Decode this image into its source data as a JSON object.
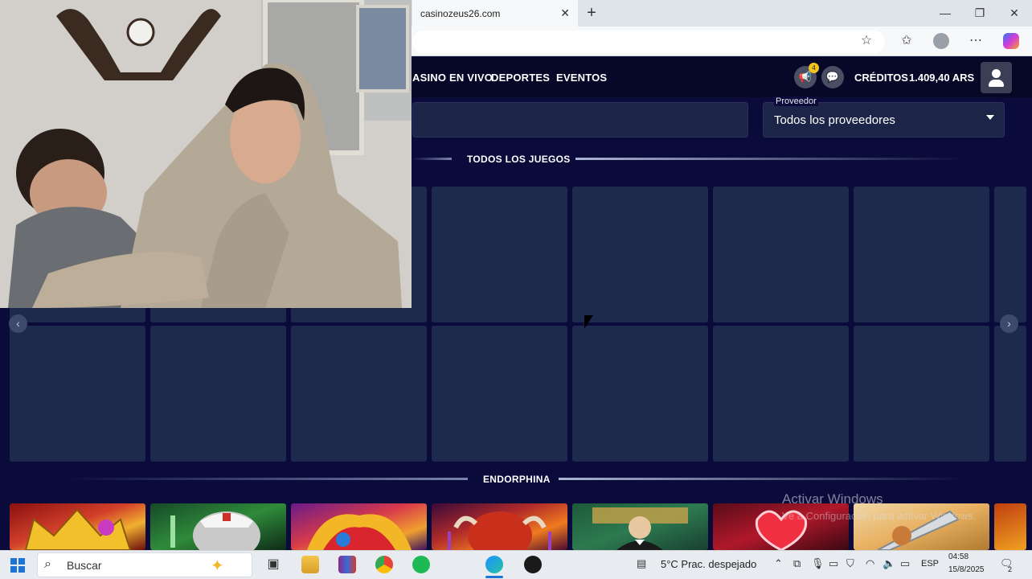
{
  "browser": {
    "tab_title": "casinozeus26.com",
    "tab_close": "✕",
    "new_tab": "+",
    "window_controls": [
      "—",
      "❐",
      "✕"
    ]
  },
  "site": {
    "nav": [
      "ASINO EN VIVO",
      "DEPORTES",
      "EVENTOS"
    ],
    "notification_count": "4",
    "credits_label": "CRÉDITOS",
    "credits_value": "1.409,40 ARS"
  },
  "filters": {
    "provider_label": "Proveedor",
    "provider_value": "Todos los proveedores"
  },
  "sections": {
    "all_games": "TODOS LOS JUEGOS",
    "endorphina": "ENDORPHINA"
  },
  "carousel": {
    "prev_icon": "‹",
    "next_icon": "›"
  },
  "watermark": {
    "title": "Activar Windows",
    "subtitle": "Ve a Configuración para activar Windows."
  },
  "taskbar": {
    "search_placeholder": "Buscar",
    "weather": "5°C  Prac. despejado",
    "language": "ESP",
    "time": "04:58",
    "date": "15/8/2025",
    "notifications": "2"
  },
  "colors": {
    "page_bg": "#0a0b3a",
    "tile_bg": "#1d2a4d",
    "header_bg": "#070828",
    "badge": "#f3c41d"
  }
}
